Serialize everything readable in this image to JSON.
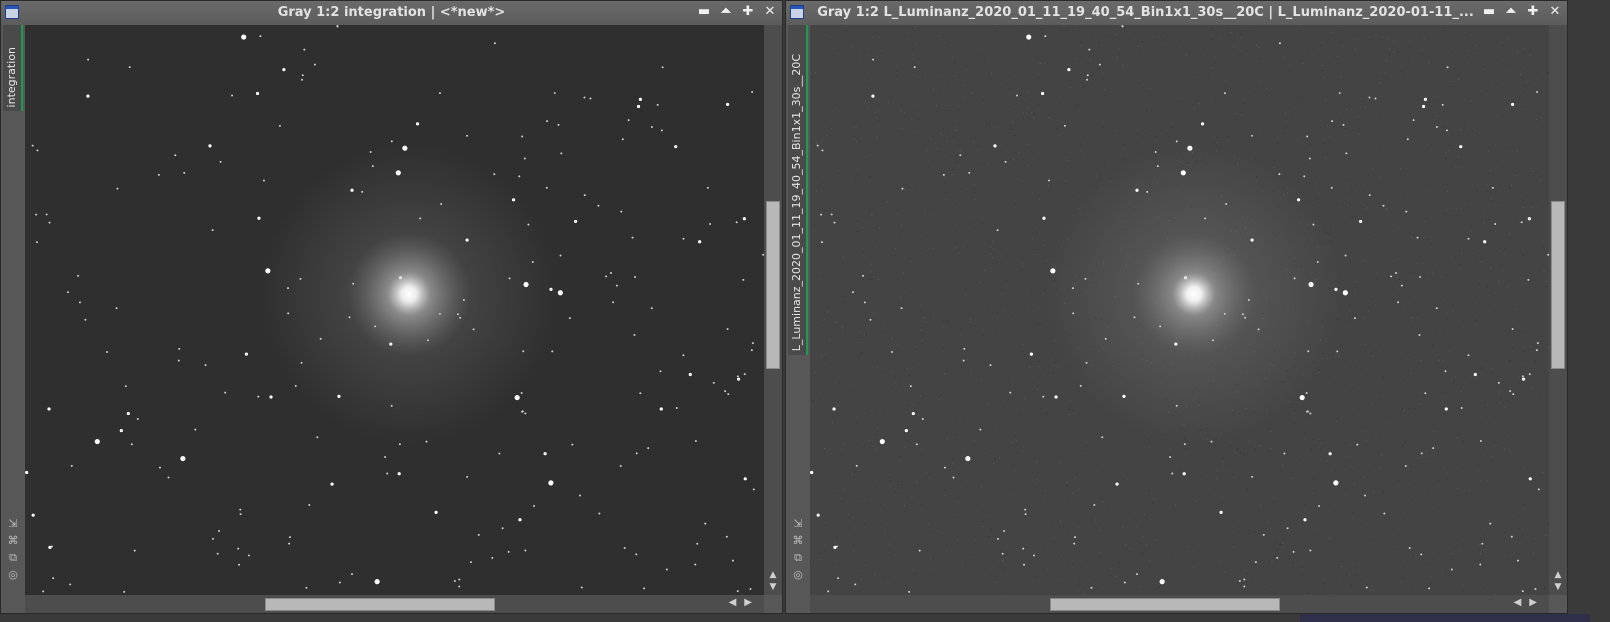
{
  "windows": [
    {
      "title": "Gray 1:2 integration | <*new*>",
      "tab_label": "integration",
      "image_kind": "integrated",
      "controls": {
        "minimize": "▬",
        "shade": "⏶",
        "maximize": "✚",
        "close": "✕"
      }
    },
    {
      "title": "Gray 1:2 L_Luminanz_2020_01_11_19_40_54_Bin1x1_30s__20C | L_Luminanz_2020-01-11_...",
      "tab_label": "L_Luminanz_2020_01_11_19_40_54_Bin1x1_30s__20C",
      "image_kind": "single-frame",
      "controls": {
        "minimize": "▬",
        "shade": "⏶",
        "maximize": "✚",
        "close": "✕"
      }
    }
  ],
  "side_tool_icons": [
    "arrow-to-corner-icon",
    "fit-view-icon",
    "clone-view-icon",
    "target-icon"
  ],
  "colors": {
    "selected_tab": "#1a9c52",
    "title_icon": "#2856b8",
    "sky_integrated": "#2f2f2f",
    "sky_single": "#444444"
  }
}
